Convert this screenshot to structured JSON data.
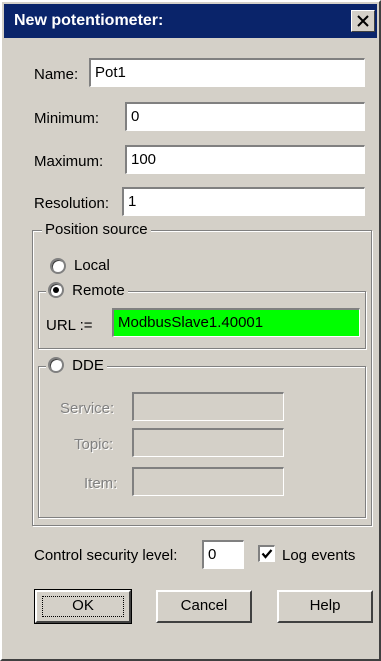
{
  "window": {
    "title": "New potentiometer:"
  },
  "fields": {
    "name_label": "Name:",
    "name_value": "Pot1",
    "minimum_label": "Minimum:",
    "minimum_value": "0",
    "maximum_label": "Maximum:",
    "maximum_value": "100",
    "resolution_label": "Resolution:",
    "resolution_value": "1"
  },
  "position_source": {
    "legend": "Position source",
    "local_label": "Local",
    "remote_label": "Remote",
    "url_label": "URL :=",
    "url_value": "ModbusSlave1.40001",
    "url_color": "#00ff00",
    "dde_label": "DDE",
    "service_label": "Service:",
    "topic_label": "Topic:",
    "item_label": "Item:",
    "selected": "Remote"
  },
  "security": {
    "label": "Control security level:",
    "value": "0",
    "log_events_label": "Log events",
    "log_events_checked": true
  },
  "buttons": {
    "ok": "OK",
    "cancel": "Cancel",
    "help": "Help"
  },
  "colors": {
    "title_bar": "#0a246a",
    "face": "#d4d0c8"
  }
}
